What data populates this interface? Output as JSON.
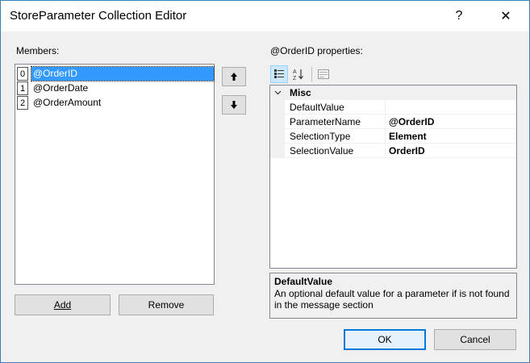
{
  "window": {
    "title": "StoreParameter Collection Editor",
    "help_icon": "?",
    "close_icon": "✕"
  },
  "members": {
    "label": "Members:",
    "items": [
      {
        "index": "0",
        "name": "@OrderID",
        "selected": true
      },
      {
        "index": "1",
        "name": "@OrderDate",
        "selected": false
      },
      {
        "index": "2",
        "name": "@OrderAmount",
        "selected": false
      }
    ],
    "move_up_icon": "🡑",
    "move_down_icon": "🡓"
  },
  "buttons": {
    "add": "Add",
    "remove": "Remove",
    "ok": "OK",
    "cancel": "Cancel"
  },
  "properties": {
    "label": "@OrderID properties:",
    "toolbar": {
      "categorized_icon": "categorized-icon",
      "alphabetical_icon": "alphabetical-icon",
      "property_pages_icon": "property-pages-icon"
    },
    "category": "Misc",
    "rows": [
      {
        "name": "DefaultValue",
        "value": ""
      },
      {
        "name": "ParameterName",
        "value": "@OrderID"
      },
      {
        "name": "SelectionType",
        "value": "Element"
      },
      {
        "name": "SelectionValue",
        "value": "OrderID"
      }
    ],
    "description": {
      "title": "DefaultValue",
      "text": "An optional default value for a parameter if is not found in the message section"
    }
  },
  "colors": {
    "selection": "#3399ff",
    "accent": "#0078d7"
  }
}
